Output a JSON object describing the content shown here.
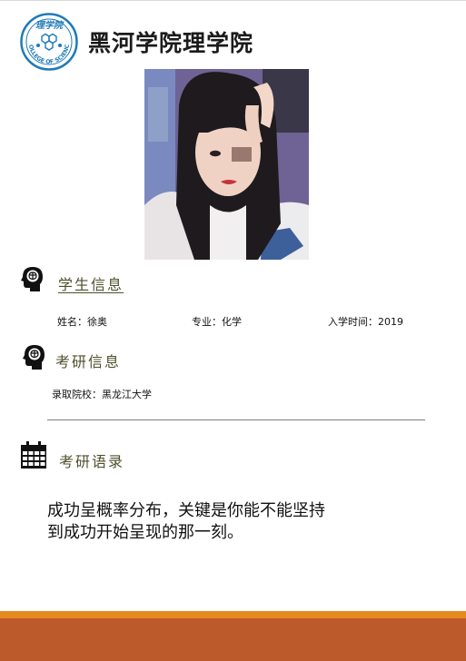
{
  "header": {
    "logo_text_top": "理学院",
    "logo_text_ring": "COLLEGE OF SCIENCE",
    "school_title": "黑河学院理学院"
  },
  "colors": {
    "logo_blue": "#1f7ab8",
    "section_title": "#4f4f2c",
    "orange_bar": "#e58a1f",
    "rust_bar": "#bd5a2c"
  },
  "student_section": {
    "title": "学生信息",
    "icon": "head-brain-icon",
    "name": "姓名：徐奥",
    "major": "专业：化学",
    "enroll": "入学时间：2019"
  },
  "exam_section": {
    "title": "考研信息",
    "icon": "head-brain-icon",
    "admitted": "录取院校：黑龙江大学"
  },
  "quote_section": {
    "title": "考研语录",
    "icon": "calendar-icon",
    "line1": "成功呈概率分布，关键是你能不能坚持",
    "line2": "到成功开始呈现的那一刻。"
  }
}
